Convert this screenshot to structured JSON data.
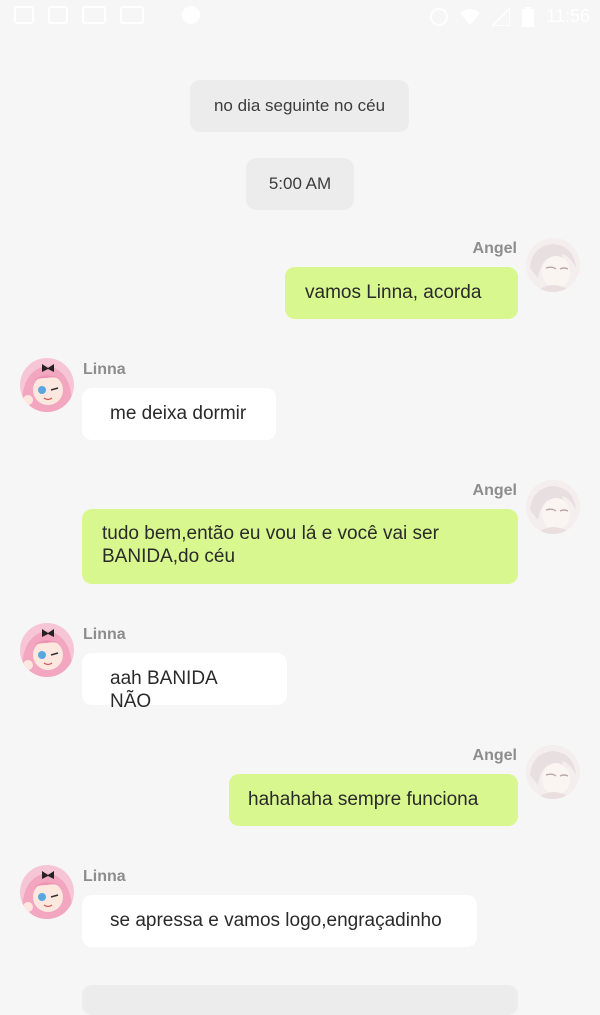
{
  "status_bar": {
    "time": "11:56",
    "left_icons": [
      "app-icon",
      "image-icon",
      "video-icon",
      "video-icon",
      "circle-icon"
    ],
    "right_icons": [
      "alarm-icon",
      "wifi-icon",
      "signal-icon",
      "battery-icon"
    ]
  },
  "chat": {
    "system_messages": [
      {
        "text": "no dia seguinte no céu"
      },
      {
        "text": "5:00 AM"
      }
    ],
    "messages": [
      {
        "sender": "Angel",
        "side": "right",
        "text": "vamos Linna, acorda"
      },
      {
        "sender": "Linna",
        "side": "left",
        "text": "me deixa dormir"
      },
      {
        "sender": "Angel",
        "side": "right",
        "text": "tudo bem,então eu vou lá e você vai ser BANIDA,do céu"
      },
      {
        "sender": "Linna",
        "side": "left",
        "text": "aah BANIDA NÃO"
      },
      {
        "sender": "Angel",
        "side": "right",
        "text": "hahahaha sempre funciona"
      },
      {
        "sender": "Linna",
        "side": "left",
        "text": "se apressa e vamos logo,engraçadinho"
      }
    ]
  },
  "colors": {
    "right_bubble": "#d8f78f",
    "left_bubble": "#ffffff",
    "background": "#f6f6f6",
    "system_bubble": "#ececec"
  }
}
